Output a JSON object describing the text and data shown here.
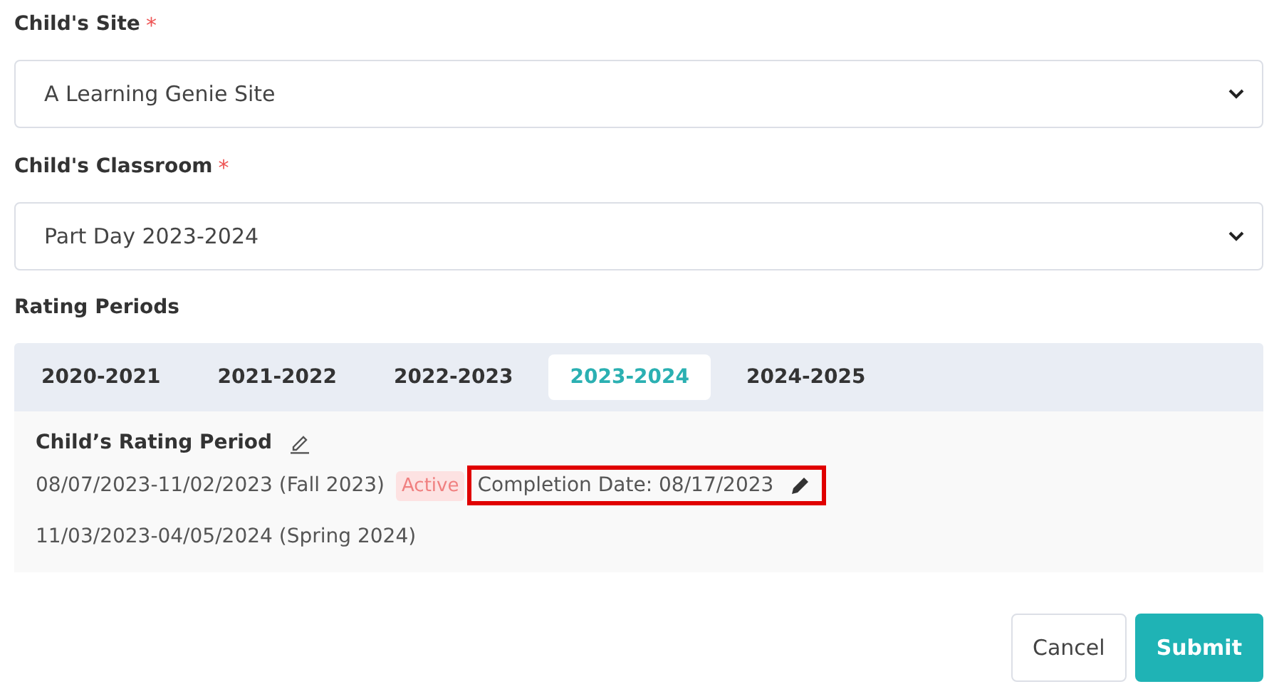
{
  "fields": [
    {
      "label": "Child's Site",
      "required_mark": "*",
      "value": "A Learning Genie Site"
    },
    {
      "label": "Child's Classroom",
      "required_mark": "*",
      "value": "Part Day 2023-2024"
    }
  ],
  "rating_periods": {
    "label": "Rating Periods",
    "tabs": [
      {
        "label": "2020-2021",
        "selected": false
      },
      {
        "label": "2021-2022",
        "selected": false
      },
      {
        "label": "2022-2023",
        "selected": false
      },
      {
        "label": "2023-2024",
        "selected": true
      },
      {
        "label": "2024-2025",
        "selected": false
      }
    ],
    "heading": "Child’s Rating Period",
    "periods": [
      {
        "range": "08/07/2023-11/02/2023 (Fall 2023)",
        "badge": "Active",
        "completion": "Completion Date: 08/17/2023",
        "highlighted": true
      },
      {
        "range": "11/03/2023-04/05/2024 (Spring 2024)"
      }
    ]
  },
  "buttons": [
    {
      "label": "Cancel",
      "kind": "secondary"
    },
    {
      "label": "Submit",
      "kind": "primary"
    }
  ]
}
